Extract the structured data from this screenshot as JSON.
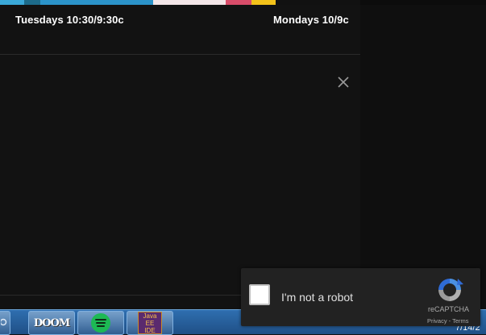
{
  "schedule": {
    "left_time": "Tuesdays 10:30/9:30c",
    "right_time": "Mondays 10/9c"
  },
  "close": {
    "icon": "close-icon"
  },
  "recaptcha": {
    "label": "I'm not a robot",
    "brand": "reCAPTCHA",
    "privacy": "Privacy",
    "separator": " - ",
    "terms": "Terms"
  },
  "taskbar": {
    "apps": [
      {
        "name": "doom",
        "label": "DOOM"
      },
      {
        "name": "spotify",
        "icon": "spotify-icon"
      },
      {
        "name": "java-ee-ide",
        "label_line1": "Java EE",
        "label_line2": "IDE"
      }
    ],
    "date": "7/14/2"
  },
  "colors": {
    "background": "#121212",
    "recaptcha_bg": "#222222",
    "spotify_green": "#1db954",
    "taskbar_blue": "#2f6fb0"
  }
}
